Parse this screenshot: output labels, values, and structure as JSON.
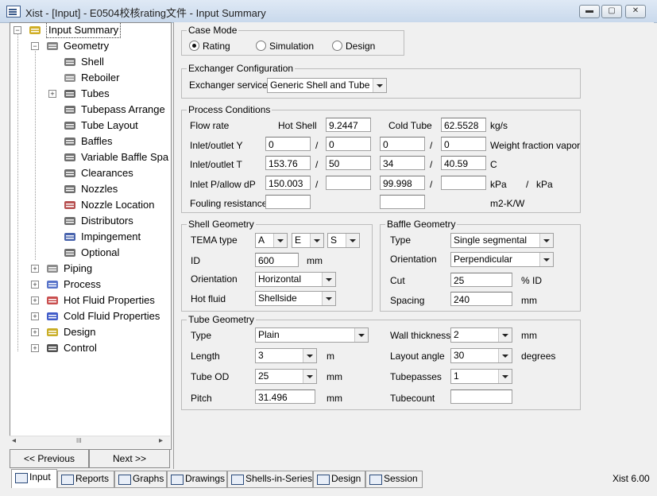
{
  "window": {
    "title": "Xist - [Input] - E0504校核rating文件 - Input Summary",
    "min": "▬",
    "max": "▢",
    "close": "✕"
  },
  "tree": [
    {
      "label": "Input Summary",
      "icon": "input-summary-icon",
      "indent": 0,
      "expander": "minus",
      "selected": true
    },
    {
      "label": "Geometry",
      "icon": "geometry-icon",
      "indent": 1,
      "expander": "minus"
    },
    {
      "label": "Shell",
      "icon": "shell-icon",
      "indent": 2,
      "expander": ""
    },
    {
      "label": "Reboiler",
      "icon": "reboiler-icon",
      "indent": 2,
      "expander": ""
    },
    {
      "label": "Tubes",
      "icon": "tubes-icon",
      "indent": 2,
      "expander": "plus"
    },
    {
      "label": "Tubepass Arrange",
      "icon": "tubepass-icon",
      "indent": 2,
      "expander": ""
    },
    {
      "label": "Tube Layout",
      "icon": "tube-layout-icon",
      "indent": 2,
      "expander": ""
    },
    {
      "label": "Baffles",
      "icon": "baffles-icon",
      "indent": 2,
      "expander": ""
    },
    {
      "label": "Variable Baffle Spa",
      "icon": "variable-baffle-icon",
      "indent": 2,
      "expander": ""
    },
    {
      "label": "Clearances",
      "icon": "clearances-icon",
      "indent": 2,
      "expander": ""
    },
    {
      "label": "Nozzles",
      "icon": "nozzles-icon",
      "indent": 2,
      "expander": ""
    },
    {
      "label": "Nozzle Location",
      "icon": "nozzle-location-icon",
      "indent": 2,
      "expander": ""
    },
    {
      "label": "Distributors",
      "icon": "distributors-icon",
      "indent": 2,
      "expander": ""
    },
    {
      "label": "Impingement",
      "icon": "impingement-icon",
      "indent": 2,
      "expander": ""
    },
    {
      "label": "Optional",
      "icon": "optional-icon",
      "indent": 2,
      "expander": ""
    },
    {
      "label": "Piping",
      "icon": "piping-icon",
      "indent": 1,
      "expander": "plus"
    },
    {
      "label": "Process",
      "icon": "process-icon",
      "indent": 1,
      "expander": "plus"
    },
    {
      "label": "Hot Fluid Properties",
      "icon": "hot-fluid-icon",
      "indent": 1,
      "expander": "plus"
    },
    {
      "label": "Cold Fluid Properties",
      "icon": "cold-fluid-icon",
      "indent": 1,
      "expander": "plus"
    },
    {
      "label": "Design",
      "icon": "design-icon",
      "indent": 1,
      "expander": "plus"
    },
    {
      "label": "Control",
      "icon": "control-icon",
      "indent": 1,
      "expander": "plus"
    }
  ],
  "tree_scroll": {
    "left": "◂",
    "thumb": "III",
    "right": "▸"
  },
  "nav": {
    "previous": "<< Previous",
    "next": "Next >>"
  },
  "case_mode": {
    "title": "Case Mode",
    "options": [
      {
        "label": "Rating",
        "selected": true
      },
      {
        "label": "Simulation",
        "selected": false
      },
      {
        "label": "Design",
        "selected": false
      }
    ]
  },
  "exchanger_config": {
    "title": "Exchanger Configuration",
    "service_label": "Exchanger service",
    "service_value": "Generic Shell and Tube"
  },
  "process": {
    "title": "Process Conditions",
    "flow_label": "Flow rate",
    "hot_label": "Hot Shell",
    "hot_flow": "9.2447",
    "cold_label": "Cold Tube",
    "cold_flow": "62.5528",
    "flow_unit": "kg/s",
    "y_label": "Inlet/outlet Y",
    "hot_y_in": "0",
    "hot_y_out": "0",
    "cold_y_in": "0",
    "cold_y_out": "0",
    "y_unit": "Weight fraction vapor",
    "t_label": "Inlet/outlet T",
    "hot_t_in": "153.76",
    "hot_t_out": "50",
    "cold_t_in": "34",
    "cold_t_out": "40.59",
    "t_unit": "C",
    "p_label": "Inlet P/allow dP",
    "hot_p_in": "150.003",
    "hot_p_dp": "",
    "cold_p_in": "99.998",
    "cold_p_dp": "",
    "p_unit1": "kPa",
    "p_sep": "/",
    "p_unit2": "kPa",
    "f_label": "Fouling resistance",
    "hot_f": "",
    "cold_f": "",
    "f_unit": "m2-K/W",
    "slash": "/"
  },
  "shell_geometry": {
    "title": "Shell Geometry",
    "tema_label": "TEMA type",
    "tema_front": "A",
    "tema_shell": "E",
    "tema_rear": "S",
    "id_label": "ID",
    "id_value": "600",
    "id_unit": "mm",
    "orientation_label": "Orientation",
    "orientation_value": "Horizontal",
    "hotfluid_label": "Hot fluid",
    "hotfluid_value": "Shellside"
  },
  "baffle_geometry": {
    "title": "Baffle Geometry",
    "type_label": "Type",
    "type_value": "Single segmental",
    "orientation_label": "Orientation",
    "orientation_value": "Perpendicular",
    "cut_label": "Cut",
    "cut_value": "25",
    "cut_unit": "% ID",
    "spacing_label": "Spacing",
    "spacing_value": "240",
    "spacing_unit": "mm"
  },
  "tube_geometry": {
    "title": "Tube Geometry",
    "type_label": "Type",
    "type_value": "Plain",
    "length_label": "Length",
    "length_value": "3",
    "length_unit": "m",
    "od_label": "Tube OD",
    "od_value": "25",
    "od_unit": "mm",
    "pitch_label": "Pitch",
    "pitch_value": "31.496",
    "pitch_unit": "mm",
    "wall_label": "Wall thickness",
    "wall_value": "2",
    "wall_unit": "mm",
    "angle_label": "Layout angle",
    "angle_value": "30",
    "angle_unit": "degrees",
    "passes_label": "Tubepasses",
    "passes_value": "1",
    "count_label": "Tubecount",
    "count_value": ""
  },
  "tabs": [
    {
      "label": "Input",
      "icon": "input-tab-icon",
      "active": true
    },
    {
      "label": "Reports",
      "icon": "reports-tab-icon",
      "active": false
    },
    {
      "label": "Graphs",
      "icon": "graphs-tab-icon",
      "active": false
    },
    {
      "label": "Drawings",
      "icon": "drawings-tab-icon",
      "active": false
    },
    {
      "label": "Shells-in-Series",
      "icon": "shells-in-series-tab-icon",
      "active": false
    },
    {
      "label": "Design",
      "icon": "design-tab-icon",
      "active": false
    },
    {
      "label": "Session",
      "icon": "session-tab-icon",
      "active": false
    }
  ],
  "status": {
    "version": "Xist 6.00"
  }
}
